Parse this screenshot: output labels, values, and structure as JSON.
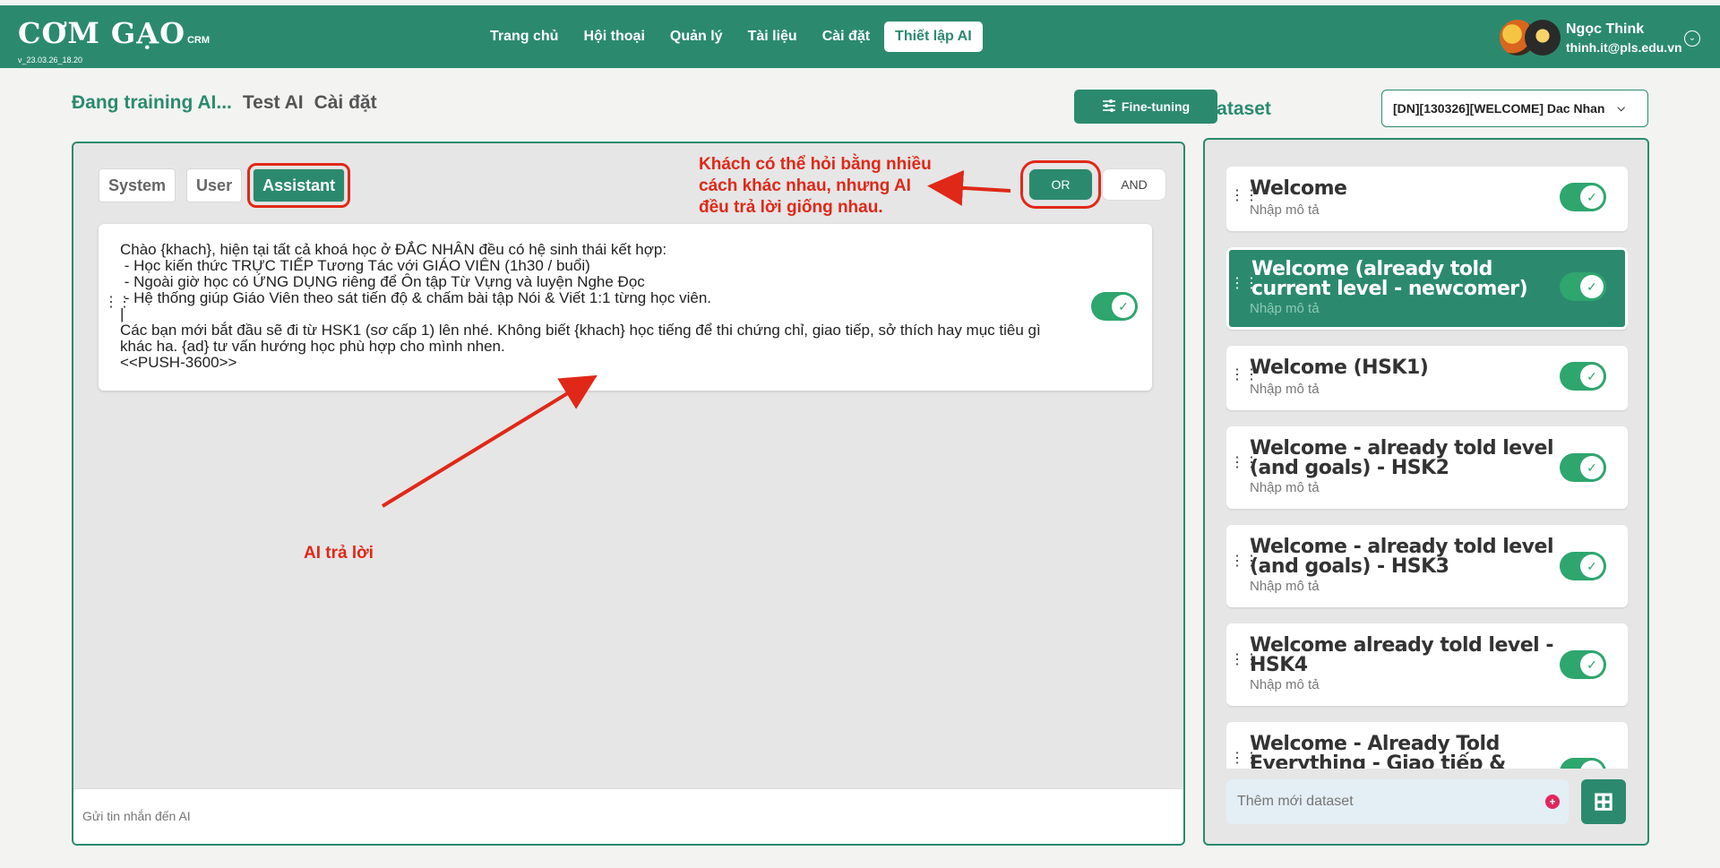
{
  "header": {
    "logo_text": "CƠM GẠO",
    "logo_suffix": "CRM",
    "version": "v_23.03.26_18.20",
    "nav": [
      {
        "label": "Trang chủ"
      },
      {
        "label": "Hội thoại"
      },
      {
        "label": "Quản lý"
      },
      {
        "label": "Tài liệu"
      },
      {
        "label": "Cài đặt"
      },
      {
        "label": "Thiết lập AI",
        "active": true
      }
    ],
    "user": {
      "name": "Ngọc Think",
      "email": "thinh.it@pls.edu.vn"
    }
  },
  "subtabs": [
    {
      "label": "Đang training AI...",
      "active": true
    },
    {
      "label": "Test AI"
    },
    {
      "label": "Cài đặt"
    }
  ],
  "finetune_label": "Fine-tuning",
  "dataset": {
    "title": "Dataset",
    "selected": "[DN][130326][WELCOME] Dac Nhan",
    "items": [
      {
        "title": "Welcome",
        "desc": "Nhập mô tả",
        "enabled": true
      },
      {
        "title": "Welcome (already told current level - newcomer)",
        "desc": "Nhập mô tả",
        "enabled": true,
        "active": true
      },
      {
        "title": "Welcome (HSK1)",
        "desc": "Nhập mô tả",
        "enabled": true
      },
      {
        "title": "Welcome - already told level (and goals) - HSK2",
        "desc": "Nhập mô tả",
        "enabled": true
      },
      {
        "title": "Welcome - already told level (and goals) - HSK3",
        "desc": "Nhập mô tả",
        "enabled": true
      },
      {
        "title": "Welcome already told level - HSK4",
        "desc": "Nhập mô tả",
        "enabled": true
      },
      {
        "title": "Welcome - Already Told Everything - Giao tiếp &",
        "desc": "",
        "enabled": true
      }
    ],
    "add_placeholder": "Thêm mới dataset"
  },
  "editor": {
    "roles": [
      {
        "label": "System"
      },
      {
        "label": "User"
      },
      {
        "label": "Assistant",
        "active": true
      }
    ],
    "logic": [
      {
        "label": "OR",
        "active": true
      },
      {
        "label": "AND"
      }
    ],
    "message": "Chào {khach}, hiện tại tất cả khoá học ở ĐẮC NHÂN đều có hệ sinh thái kết hợp:\n - Học kiến thức TRỰC TIẾP Tương Tác với GIÁO VIÊN (1h30 / buổi)\n - Ngoài giờ học có ỨNG DỤNG riêng để Ôn tập Từ Vựng và luyện Nghe Đọc\n - Hệ thống giúp Giáo Viên theo sát tiến độ & chấm bài tập Nói & Viết 1:1 từng học viên.\n|\nCác bạn mới bắt đầu sẽ đi từ HSK1 (sơ cấp 1) lên nhé. Không biết {khach} học tiếng để thi chứng chỉ, giao tiếp, sở thích hay mục tiêu gì khác ha. {ad} tư vấn hướng học phù hợp cho mình nhen.\n<<PUSH-3600>>",
    "message_enabled": true,
    "send_placeholder": "Gửi tin nhắn đến AI"
  },
  "annotations": {
    "top": "Khách có thể hỏi bằng nhiều\ncách khác nhau, nhưng AI\nđều trả lời giống nhau.",
    "bottom": "AI trả lời",
    "color": "#e02818"
  },
  "colors": {
    "brand": "#2b8a6e",
    "toggle_on": "#2ea66e"
  }
}
